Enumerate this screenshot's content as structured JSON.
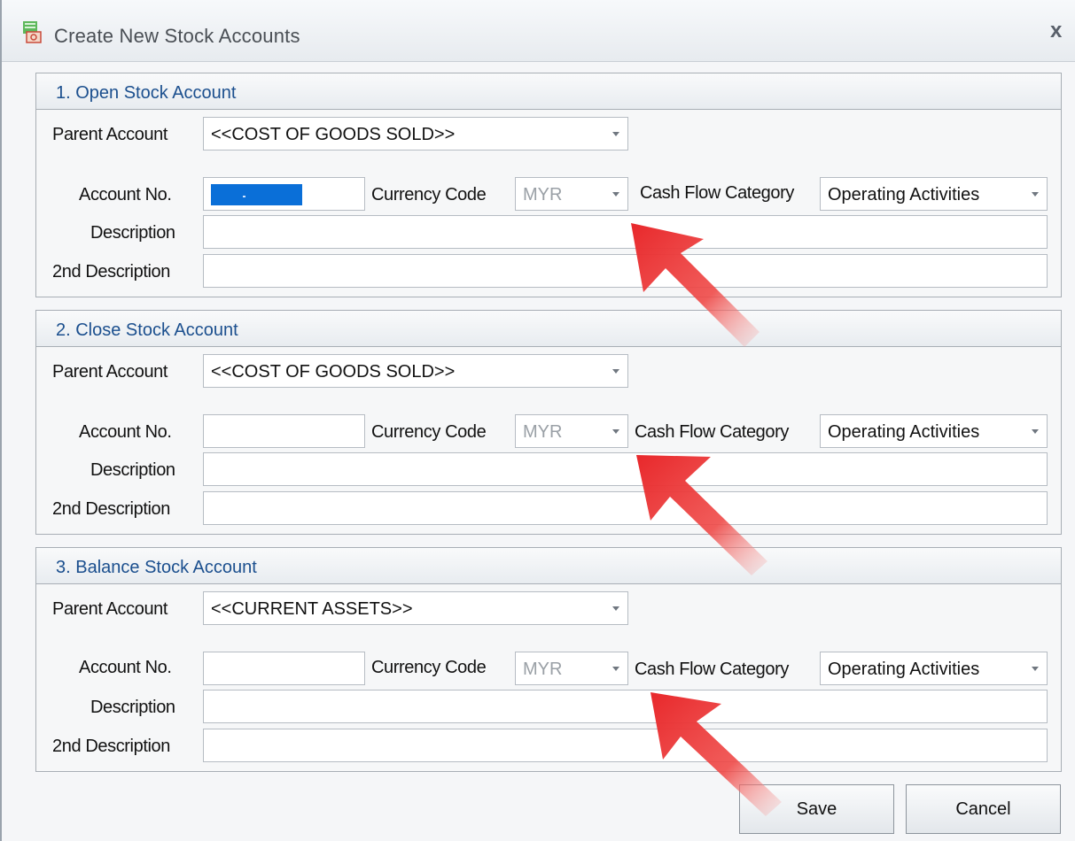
{
  "window": {
    "title": "Create New Stock Accounts",
    "close_symbol": "x"
  },
  "labels": {
    "parent_account": "Parent Account",
    "account_no": "Account No.",
    "currency_code": "Currency Code",
    "cash_flow_category": "Cash Flow Category",
    "description": "Description",
    "second_description": "2nd Description"
  },
  "sections": [
    {
      "title": "1.  Open Stock Account",
      "parent_account": "<<COST OF GOODS SOLD>>",
      "account_no": "",
      "currency_code": "MYR",
      "cash_flow_category": "Operating Activities",
      "description": "",
      "second_description": ""
    },
    {
      "title": "2.  Close Stock Account",
      "parent_account": "<<COST OF GOODS SOLD>>",
      "account_no": "",
      "currency_code": "MYR",
      "cash_flow_category": "Operating Activities",
      "description": "",
      "second_description": ""
    },
    {
      "title": "3.  Balance Stock Account",
      "parent_account": "<<CURRENT ASSETS>>",
      "account_no": "",
      "currency_code": "MYR",
      "cash_flow_category": "Operating Activities",
      "description": "",
      "second_description": ""
    }
  ],
  "buttons": {
    "save": "Save",
    "cancel": "Cancel"
  },
  "colors": {
    "section_title": "#1b4f8e",
    "selection": "#0a6fd8",
    "annotation_arrow": "#e8282b"
  },
  "icons": {
    "app": "stock-accounts-icon",
    "close": "close-icon",
    "dropdown": "chevron-down-icon"
  }
}
